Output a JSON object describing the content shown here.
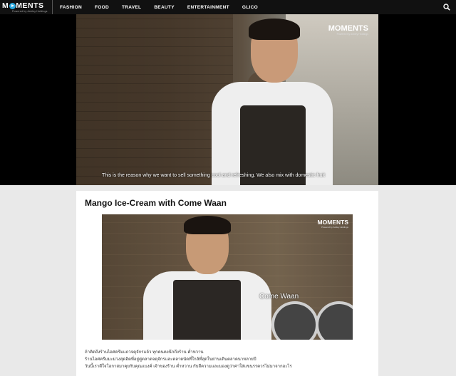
{
  "header": {
    "logo": "MOMENTS",
    "logo_sub": "Powered by Ashley Holdings",
    "nav": [
      "FASHION",
      "FOOD",
      "TRAVEL",
      "BEAUTY",
      "ENTERTAINMENT",
      "GLICO"
    ],
    "search_icon": "search-icon"
  },
  "hero": {
    "watermark": "MOMENTS",
    "watermark_sub": "Powered by Ashley Holdings",
    "subtitle": "This is the reason why we want to sell something cool and refreshing. We also mix with domestic fruit"
  },
  "article": {
    "title": "Mango Ice-Cream with Come Waan",
    "photo_watermark": "MOMENTS",
    "photo_watermark_sub": "Powered by Ashley Holdings",
    "photo_caption": "Come Waan",
    "body_lines": [
      "ถ้าคิดถึงร้านไอศครีมแถวจตุจักรแล้ว ทุกคนคงนึกถึงร้าน ค่ำหวาน",
      "ร้านไอศครีมมะม่วงสุดฮิตที่อยู่คู่ตลาดจตุจักรและตลาดนัดที่ใกล้ที่สุดในย่านเดินตลาดนาหลายปี",
      "วันนี้เราดีใจโอกาสมาคุยกับคุณแบงค์ เจ้าของร้าน ค่ำหวาน กับสีความและมองดูว่าค่าใส่แขนรรควรไม่มาจากอะไร"
    ]
  }
}
